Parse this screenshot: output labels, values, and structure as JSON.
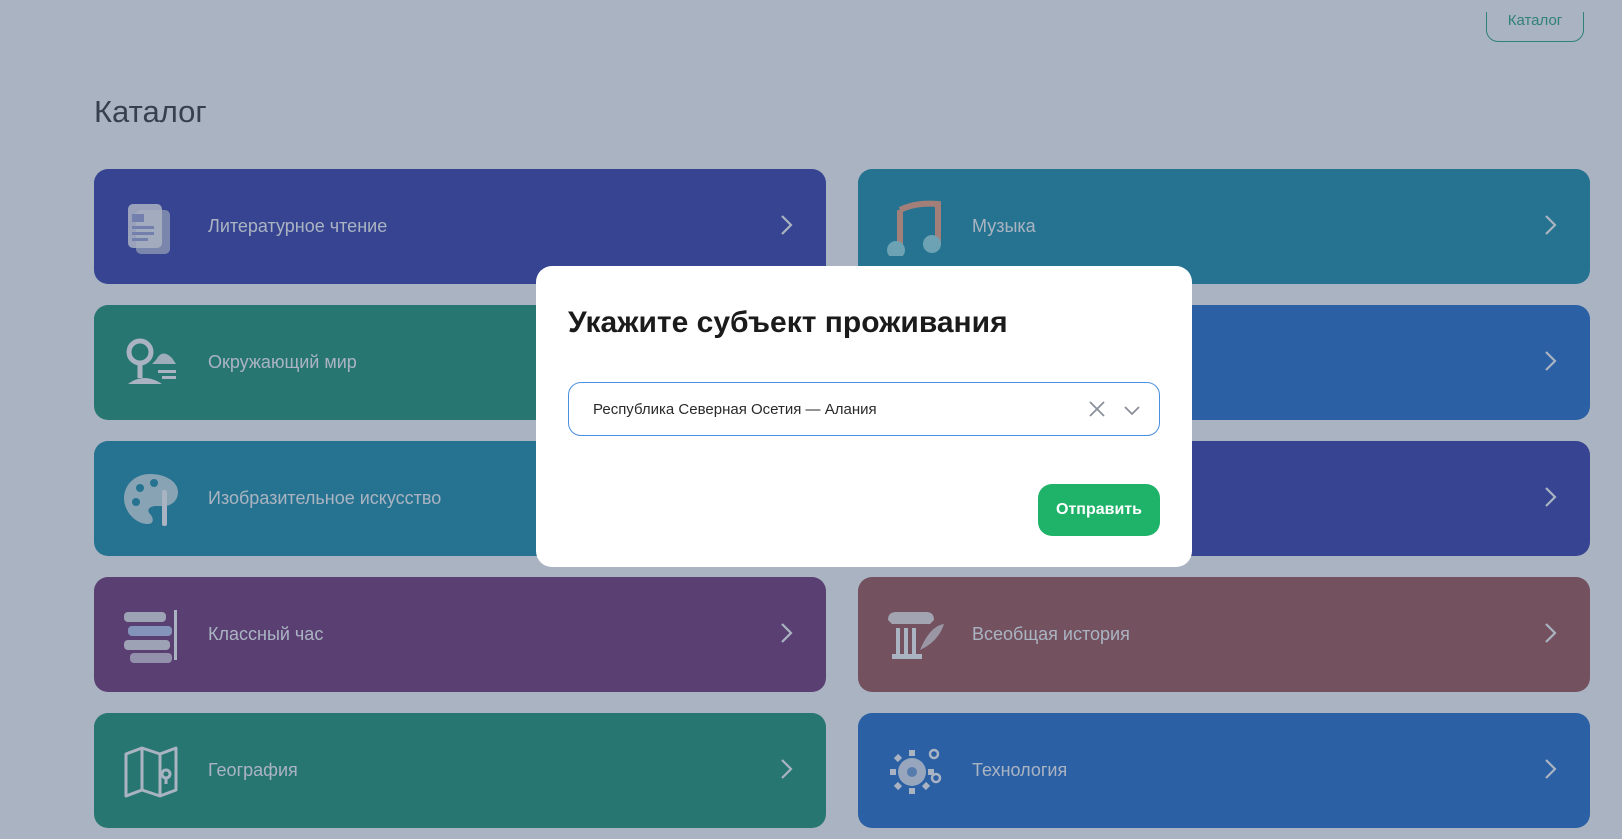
{
  "header": {
    "catalog_button": "Каталог"
  },
  "page": {
    "title": "Каталог"
  },
  "cards": [
    {
      "label": "Литературное чтение",
      "color": "#2a33a6",
      "icon": "documents-icon"
    },
    {
      "label": "Музыка",
      "color": "#0a8aa4",
      "icon": "music-note-icon"
    },
    {
      "label": "Окружающий мир",
      "color": "#0e8f6e",
      "icon": "nature-icon"
    },
    {
      "label": "",
      "color": "#1666cc",
      "icon": ""
    },
    {
      "label": "Изобразительное искусство",
      "color": "#0a8aa4",
      "icon": "palette-icon"
    },
    {
      "label": "",
      "color": "#2a33a6",
      "icon": ""
    },
    {
      "label": "Классный час",
      "color": "#6c2a6e",
      "icon": "books-icon"
    },
    {
      "label": "Всеобщая история",
      "color": "#9a4b4b",
      "icon": "column-icon"
    },
    {
      "label": "География",
      "color": "#0e8f6e",
      "icon": "map-icon"
    },
    {
      "label": "Технология",
      "color": "#1666cc",
      "icon": "gear-icon"
    }
  ],
  "modal": {
    "title": "Укажите субъект проживания",
    "selected_region": "Республика Северная Осетия — Алания",
    "submit_label": "Отправить",
    "accent_color": "#1fb36a",
    "focus_color": "#4a8fe0"
  }
}
